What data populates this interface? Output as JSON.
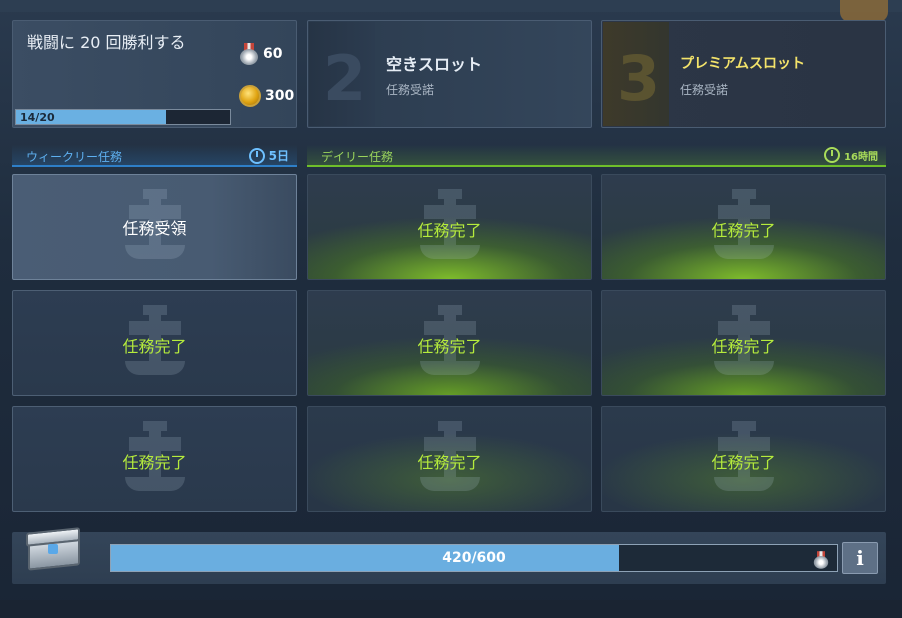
{
  "slots": {
    "slot1": {
      "title": "戦闘に 20 回勝利する",
      "reward_medals": "60",
      "reward_coins": "300",
      "progress_text": "14/20",
      "progress": 0.7
    },
    "slot2": {
      "number": "2",
      "name": "空きスロット",
      "sub": "任務受諾"
    },
    "slot3": {
      "number": "3",
      "name": "プレミアムスロット",
      "sub": "任務受諾"
    }
  },
  "weekly": {
    "label": "ウィークリー任務",
    "timer": "5日",
    "cards": [
      {
        "text": "任務受領",
        "state": "active"
      },
      {
        "text": "任務完了",
        "state": "done"
      },
      {
        "text": "任務完了",
        "state": "done"
      }
    ]
  },
  "daily": {
    "label": "デイリー任務",
    "timer": "16時間",
    "cards": [
      {
        "text": "任務完了"
      },
      {
        "text": "任務完了"
      },
      {
        "text": "任務完了"
      },
      {
        "text": "任務完了"
      },
      {
        "text": "任務完了"
      },
      {
        "text": "任務完了"
      }
    ]
  },
  "chest": {
    "progress_text": "420/600",
    "progress": 0.7,
    "info_label": "i"
  },
  "colors": {
    "weekly_accent": "#2e7fc8",
    "daily_accent": "#6fbf2a",
    "complete_text": "#b6ec3c",
    "premium_text": "#f3e36a"
  }
}
